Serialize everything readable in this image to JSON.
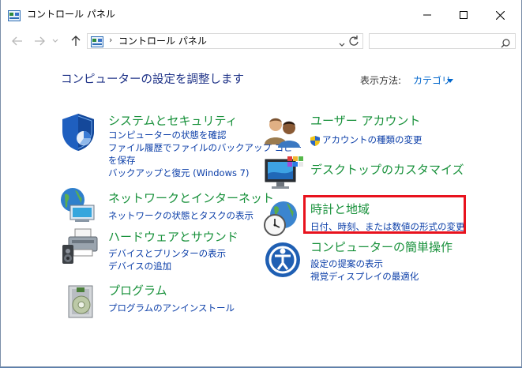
{
  "window": {
    "title": "コントロール パネル",
    "minimize_glyph": "—",
    "maximize_glyph": "☐",
    "close_glyph": "✕"
  },
  "nav": {
    "back_icon": "back-arrow-icon",
    "forward_icon": "forward-arrow-icon",
    "up_icon": "up-arrow-icon",
    "address_separator": "›",
    "address": "コントロール パネル",
    "search_placeholder": ""
  },
  "main": {
    "heading": "コンピューターの設定を調整します",
    "view_by_label": "表示方法:",
    "view_by_value": "カテゴリ"
  },
  "left_categories": [
    {
      "title": "システムとセキュリティ",
      "icon": "shield-icon",
      "links": [
        "コンピューターの状態を確認",
        "ファイル履歴でファイルのバックアップ コピー",
        "を保存",
        "バックアップと復元 (Windows 7)"
      ]
    },
    {
      "title": "ネットワークとインターネット",
      "icon": "network-globe-icon",
      "links": [
        "ネットワークの状態とタスクの表示"
      ]
    },
    {
      "title": "ハードウェアとサウンド",
      "icon": "printer-speaker-icon",
      "links": [
        "デバイスとプリンターの表示",
        "デバイスの追加"
      ]
    },
    {
      "title": "プログラム",
      "icon": "programs-disc-icon",
      "links": [
        "プログラムのアンインストール"
      ]
    }
  ],
  "right_categories": [
    {
      "title": "ユーザー アカウント",
      "icon": "users-icon",
      "links": [
        "アカウントの種類の変更"
      ]
    },
    {
      "title": "デスクトップのカスタマイズ",
      "icon": "monitor-palette-icon",
      "links": []
    },
    {
      "title": "時計と地域",
      "icon": "clock-globe-icon",
      "links": [
        "日付、時刻、または数値の形式の変更"
      ]
    },
    {
      "title": "コンピューターの簡単操作",
      "icon": "ease-of-access-icon",
      "links": [
        "設定の提案の表示",
        "視覚ディスプレイの最適化"
      ]
    }
  ],
  "colors": {
    "heading": "#1e3287",
    "category_title": "#18913b",
    "link": "#0b3ea8",
    "highlight_border": "#e8121d"
  }
}
